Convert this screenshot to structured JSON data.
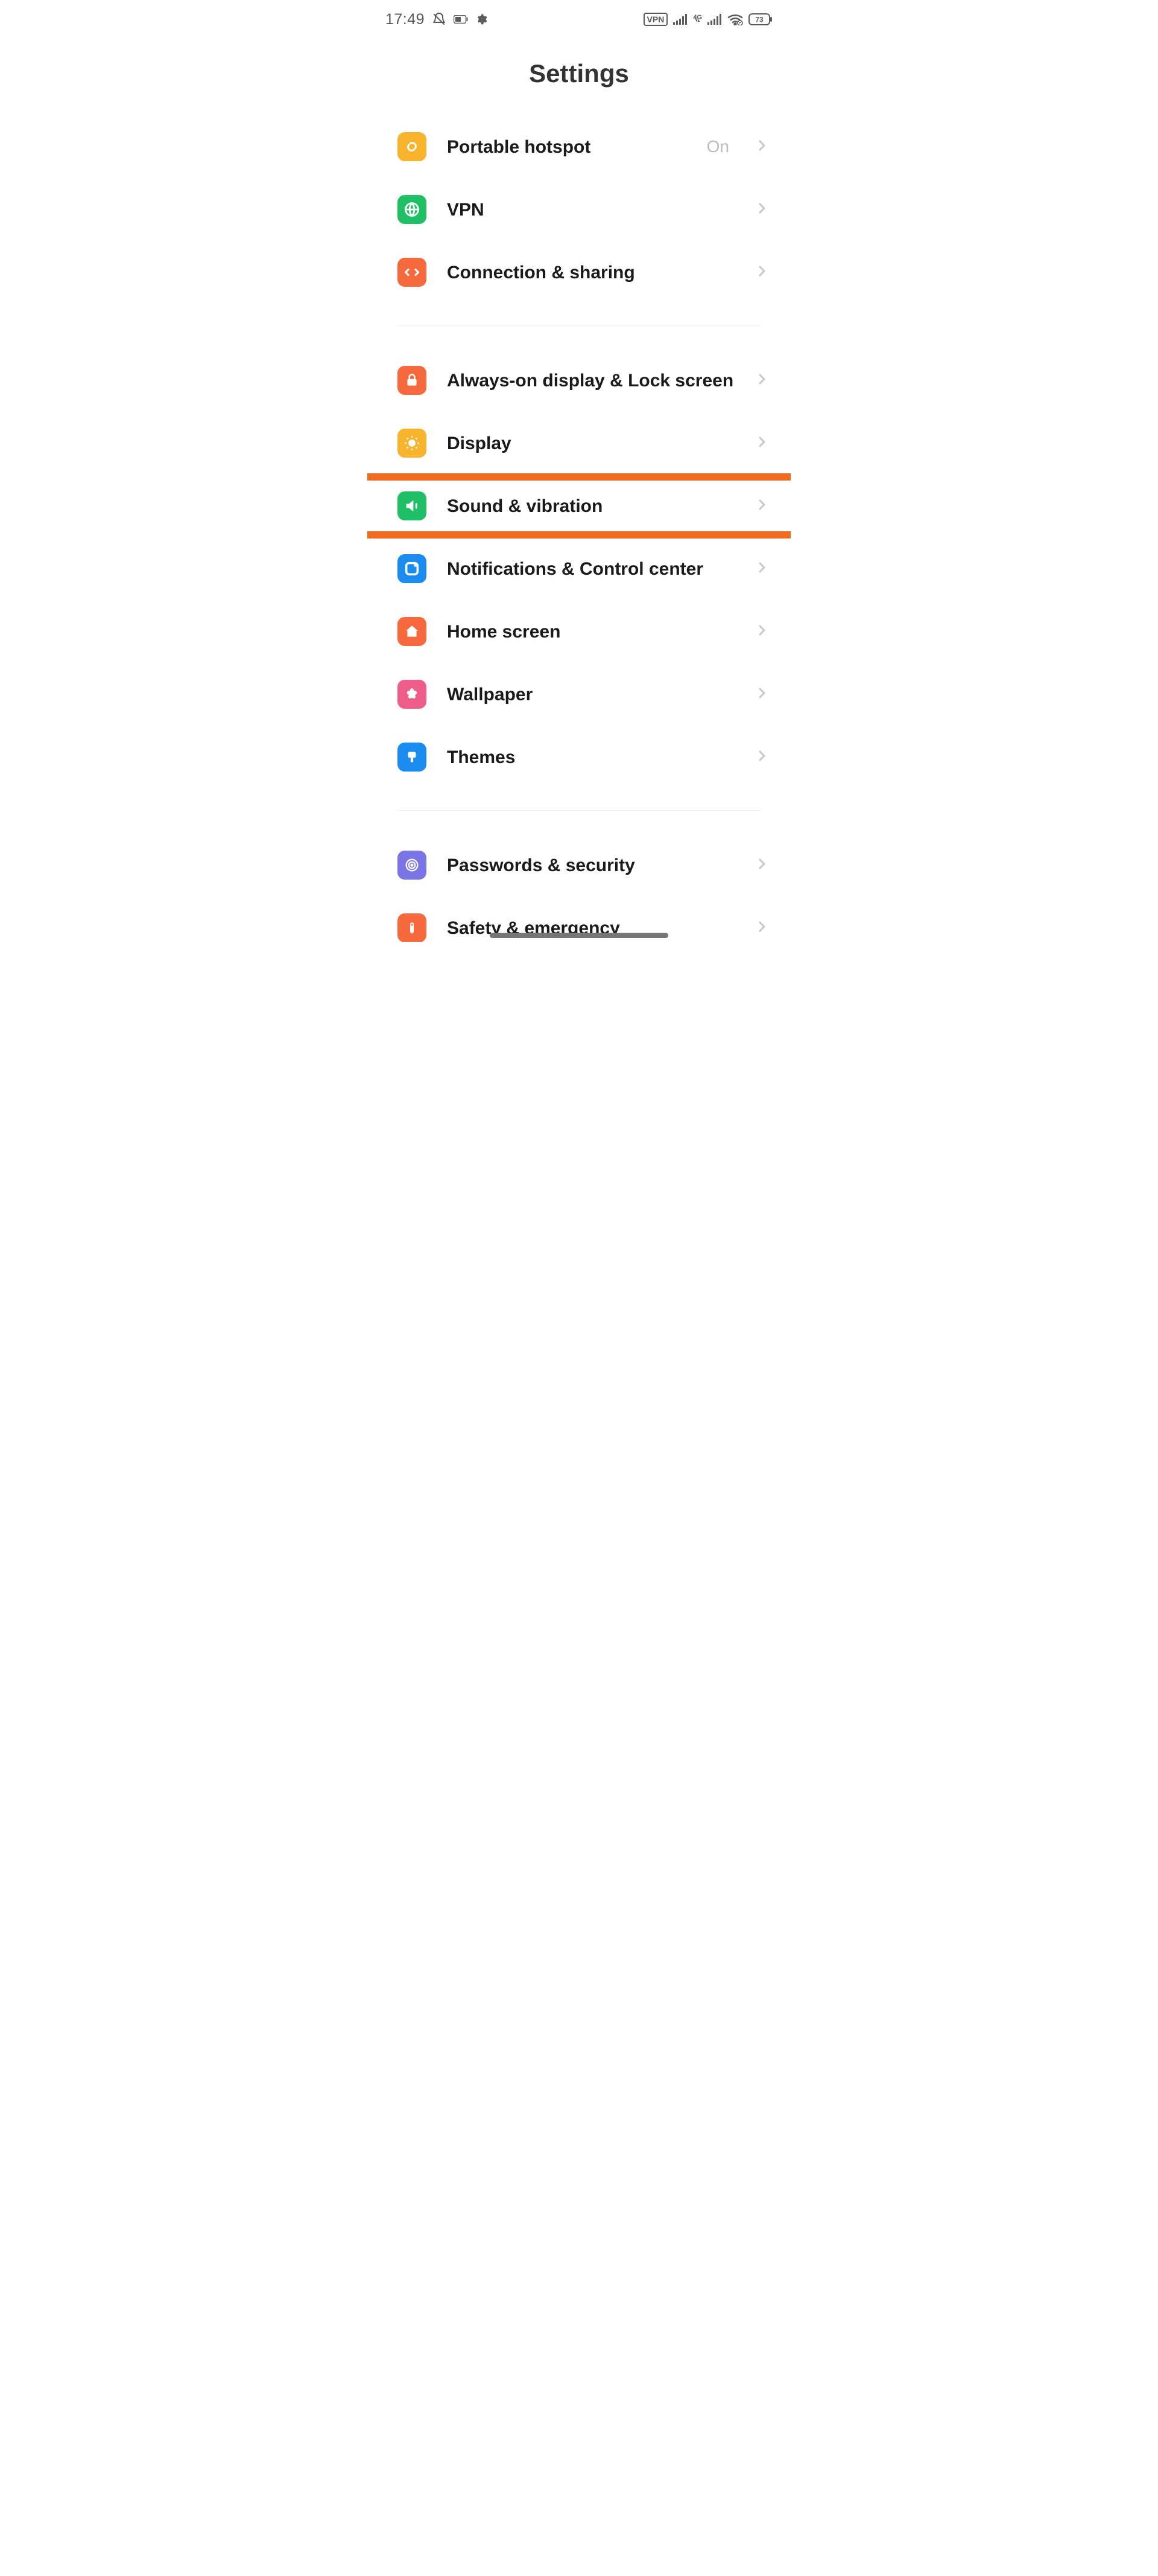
{
  "status": {
    "time": "17:49",
    "battery": "73",
    "vpn_badge": "VPN",
    "network_badge": "4G"
  },
  "page_title": "Settings",
  "groups": [
    {
      "items": [
        {
          "key": "hotspot",
          "label": "Portable hotspot",
          "value": "On",
          "icon": "link-icon",
          "icon_bg": "bg-yellow"
        },
        {
          "key": "vpn",
          "label": "VPN",
          "value": "",
          "icon": "globe-icon",
          "icon_bg": "bg-green"
        },
        {
          "key": "sharing",
          "label": "Connection & sharing",
          "value": "",
          "icon": "share-icon",
          "icon_bg": "bg-orange"
        }
      ]
    },
    {
      "items": [
        {
          "key": "aod",
          "label": "Always-on display & Lock screen",
          "value": "",
          "icon": "lock-icon",
          "icon_bg": "bg-orange2"
        },
        {
          "key": "display",
          "label": "Display",
          "value": "",
          "icon": "brightness-icon",
          "icon_bg": "bg-yellow2"
        },
        {
          "key": "sound",
          "label": "Sound & vibration",
          "value": "",
          "icon": "sound-icon",
          "icon_bg": "bg-green",
          "highlighted": true
        },
        {
          "key": "notif",
          "label": "Notifications & Control center",
          "value": "",
          "icon": "notif-icon",
          "icon_bg": "bg-blue"
        },
        {
          "key": "home",
          "label": "Home screen",
          "value": "",
          "icon": "home-icon",
          "icon_bg": "bg-orange2"
        },
        {
          "key": "wallpaper",
          "label": "Wallpaper",
          "value": "",
          "icon": "flower-icon",
          "icon_bg": "bg-pink"
        },
        {
          "key": "themes",
          "label": "Themes",
          "value": "",
          "icon": "brush-icon",
          "icon_bg": "bg-blue2"
        }
      ]
    },
    {
      "items": [
        {
          "key": "passwords",
          "label": "Passwords & security",
          "value": "",
          "icon": "fingerprint-icon",
          "icon_bg": "bg-violet"
        },
        {
          "key": "safety",
          "label": "Safety & emergency",
          "value": "",
          "icon": "safety-icon",
          "icon_bg": "bg-orange2"
        }
      ]
    }
  ]
}
